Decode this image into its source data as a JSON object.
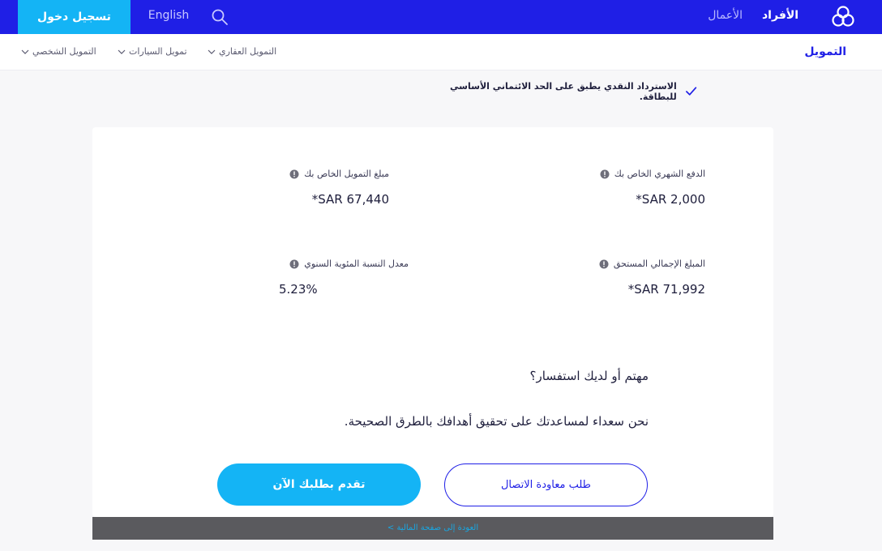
{
  "header": {
    "nav_active": "الأفراد",
    "nav_business": "الأعمال",
    "language": "English",
    "login": "تسجيل دخول",
    "accent": "#1f1fe6",
    "cta": "#14b4f5"
  },
  "subnav": {
    "title": "التمويل",
    "items": [
      "التمويل العقاري",
      "تمويل السيارات",
      "التمويل الشخصي"
    ]
  },
  "feature": {
    "text": "الاسترداد النقدي يطبق على الحد الائتماني الأساسي للبطاقة."
  },
  "summary": {
    "monthly_label": "الدفع الشهري الخاص بك",
    "monthly_value": "*SAR 2,000",
    "amount_label": "مبلغ التمويل الخاص بك",
    "amount_value": "*SAR 67,440",
    "total_label": "المبلغ الإجمالي المستحق",
    "total_value": "*SAR 71,992",
    "apr_label": "معدل النسبة المئوية السنوي",
    "apr_value": "5.23%"
  },
  "enquiry": {
    "title": "مهتم أو لديك استفسار؟",
    "subtitle": "نحن سعداء لمساعدتك على تحقيق أهدافك بالطرق الصحيحة.",
    "callback": "طلب معاودة الاتصال",
    "apply": "تقدم بطلبك الآن"
  },
  "footer": {
    "back_link": "العودة إلى صفحة المالية >"
  }
}
